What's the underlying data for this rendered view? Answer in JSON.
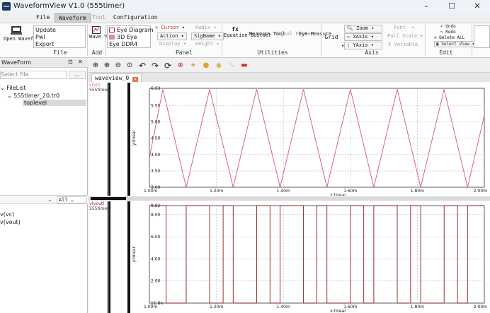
{
  "window": {
    "title": "WaveformView V1.0 (555timer)",
    "controls": [
      "–",
      "☐",
      "✕"
    ]
  },
  "menu": {
    "tabs": [
      {
        "label": "File",
        "state": "normal"
      },
      {
        "label": "Waveform",
        "state": "active"
      },
      {
        "label": "Tool",
        "state": "disabled"
      },
      {
        "label": "Configuration",
        "state": "normal"
      }
    ]
  },
  "ribbon": {
    "open_waveform": "Open Waveform",
    "file_list": [
      "Update",
      "Pwl",
      "Export"
    ],
    "file_group": "File",
    "wave_view": "Wave View",
    "add_group": "Add",
    "panel_items": [
      "Eye Diagram",
      "3D Eye",
      "Eye DDR4"
    ],
    "cursor": "+ Cursor",
    "action": "Action",
    "display": "Display",
    "radix": "Radix",
    "signame": "SigName",
    "height": "Height",
    "panel_group": "Panel",
    "fx": "fx",
    "equation_builder": "Equation Builder",
    "measure_tool": "Measure Tool",
    "signal_finder": "Signal Finder",
    "eye_measure": "Eye Measure",
    "utilities_group": "Utilities",
    "grid": "Grid",
    "zoom": "Zoom",
    "xaxis": "XAxis",
    "yaxis": "YAxis",
    "font": "Font",
    "pull_scale": "Pull Scale",
    "x_variable": "X Variable",
    "axis_group": "Axis",
    "undo": "Undo",
    "redo": "Redo",
    "delete_all": "Delete ALL",
    "select_view": "Select View",
    "edit_group": "Edit"
  },
  "left_panel": {
    "header": "WaveForm",
    "select_placeholder": "Select file",
    "browse": "...",
    "tree": [
      {
        "label": "FileList",
        "level": 0
      },
      {
        "label": "555timer_20.tr0",
        "level": 1
      },
      {
        "label": "toplevel",
        "level": 2,
        "selected": true
      }
    ],
    "filter": "All",
    "signals": [
      "v(vc)",
      "v(vout)"
    ]
  },
  "doc_tab": "waveview_0",
  "panes": [
    {
      "signal": "v(vc)",
      "source": "555timer",
      "ylabel": "y:linear",
      "xlabel": "x:linear",
      "yticks": [
        "6.03",
        "5.50",
        "5.00",
        "4.50",
        "4.00",
        "3.50",
        "3.00"
      ],
      "xticks": [
        "1.00m",
        "1.20m",
        "1.40m",
        "1.60m",
        "1.80m",
        "2.00m"
      ],
      "color": "#d9527b"
    },
    {
      "signal": "v(vout)",
      "source": "555timer",
      "ylabel": "y:linear",
      "xlabel": "x:linear",
      "yticks": [
        "8.82",
        "8.00",
        "6.00",
        "4.00",
        "2.00",
        "11.8n"
      ],
      "xticks": [
        "1.00m",
        "1.20m",
        "1.40m",
        "1.60m",
        "1.80m",
        "2.00m"
      ],
      "color": "#8b1a1a"
    }
  ],
  "chart_data": [
    {
      "type": "line",
      "title": "",
      "xlabel": "x:linear",
      "ylabel": "y:linear",
      "xlim": [
        0.001,
        0.002
      ],
      "ylim": [
        3.0,
        6.03
      ],
      "series": [
        {
          "name": "v(vc)",
          "x": [
            0.001,
            0.00104,
            0.00111,
            0.00118,
            0.00125,
            0.00132,
            0.00139,
            0.00146,
            0.00153,
            0.0016,
            0.00167,
            0.00174,
            0.00181,
            0.00188,
            0.00195,
            0.002
          ],
          "y": [
            3.9,
            6.0,
            3.0,
            6.0,
            3.0,
            6.0,
            3.0,
            6.0,
            3.0,
            6.0,
            3.0,
            6.0,
            3.0,
            6.0,
            3.0,
            5.2
          ]
        }
      ]
    },
    {
      "type": "line",
      "title": "",
      "xlabel": "x:linear",
      "ylabel": "y:linear",
      "xlim": [
        0.001,
        0.002
      ],
      "ylim": [
        1.18e-08,
        8.82
      ],
      "series": [
        {
          "name": "v(vout)",
          "x": [
            0.001,
            0.00105,
            0.00105,
            0.00111,
            0.00111,
            0.00118,
            0.00118,
            0.00122,
            0.00122,
            0.00125,
            0.00125,
            0.00132,
            0.00132,
            0.00136,
            0.00136,
            0.00139,
            0.00139,
            0.00146,
            0.00146,
            0.0015,
            0.0015,
            0.00153,
            0.00153,
            0.0016,
            0.0016,
            0.00164,
            0.00164,
            0.00167,
            0.00167,
            0.00174,
            0.00174,
            0.00178,
            0.00178,
            0.00181,
            0.00181,
            0.00188,
            0.00188,
            0.00192,
            0.00192,
            0.00195,
            0.00195,
            0.002
          ],
          "y": [
            8.82,
            8.82,
            0.0,
            0.0,
            8.82,
            8.82,
            0.0,
            0.0,
            8.82,
            8.82,
            0.0,
            0.0,
            8.82,
            8.82,
            0.0,
            0.0,
            8.82,
            8.82,
            0.0,
            0.0,
            8.82,
            8.82,
            0.0,
            0.0,
            8.82,
            8.82,
            0.0,
            0.0,
            8.82,
            8.82,
            0.0,
            0.0,
            8.82,
            8.82,
            0.0,
            0.0,
            8.82,
            8.82,
            0.0,
            0.0,
            8.82,
            8.82
          ]
        }
      ]
    }
  ]
}
